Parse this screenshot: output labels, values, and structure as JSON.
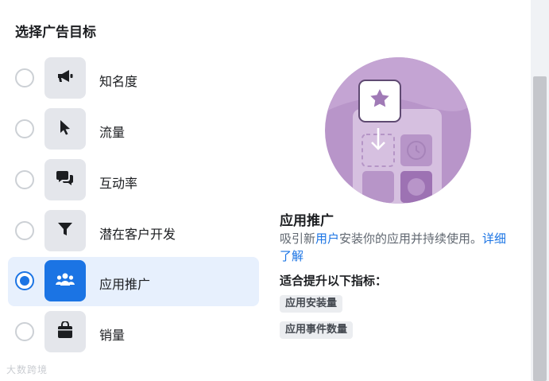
{
  "dialog": {
    "title": "选择广告目标"
  },
  "objectives": [
    {
      "label": "知名度",
      "icon": "megaphone-icon",
      "selected": false
    },
    {
      "label": "流量",
      "icon": "cursor-icon",
      "selected": false
    },
    {
      "label": "互动率",
      "icon": "chat-bubbles-icon",
      "selected": false
    },
    {
      "label": "潜在客户开发",
      "icon": "funnel-icon",
      "selected": false
    },
    {
      "label": "应用推广",
      "icon": "people-group-icon",
      "selected": true
    },
    {
      "label": "销量",
      "icon": "shopping-bag-icon",
      "selected": false
    }
  ],
  "detail": {
    "title": "应用推广",
    "description_before": "吸引新",
    "description_highlight": "用户",
    "description_after": "安装你的应用并持续使用。",
    "learn_more": "详细了解",
    "metrics_heading": "适合提升以下指标：",
    "metrics": [
      "应用安装量",
      "应用事件数量"
    ]
  },
  "watermark": "大数跨境",
  "colors": {
    "accent": "#1b74e4",
    "selected_bg": "#e7f0fd",
    "tile_bg": "#e4e6eb",
    "illustration_purple": "#b895c9"
  }
}
